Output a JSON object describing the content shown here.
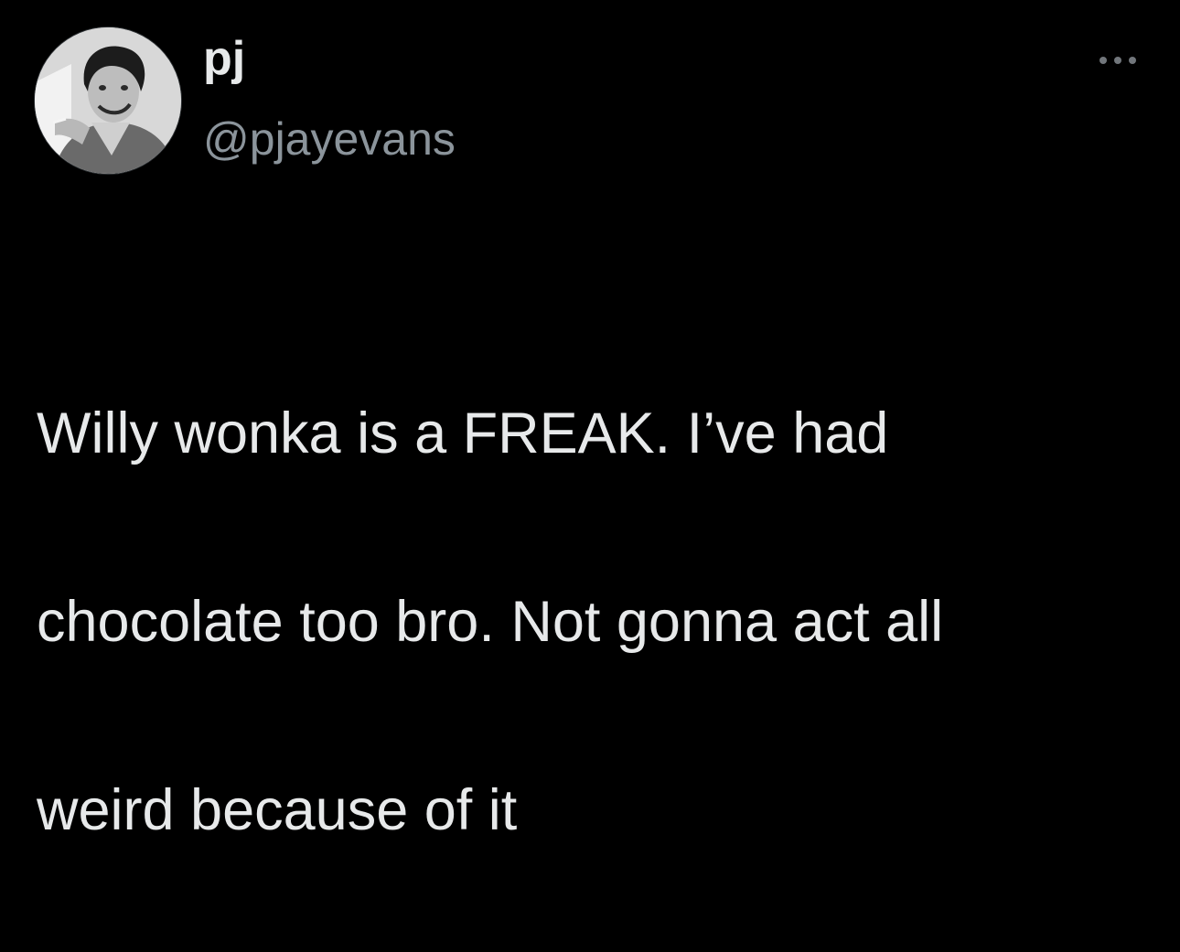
{
  "tweet": {
    "author": {
      "display_name": "pj",
      "handle": "@pjayevans",
      "avatar_icon": "profile-photo-avatar"
    },
    "more_icon": "more-options-icon",
    "text_lines": [
      "Willy wonka is a FREAK. I’ve had",
      "chocolate too bro. Not gonna act all",
      "weird because of it"
    ]
  },
  "colors": {
    "background": "#000000",
    "primary_text": "#e7e9ea",
    "secondary_text": "#8b949b"
  }
}
